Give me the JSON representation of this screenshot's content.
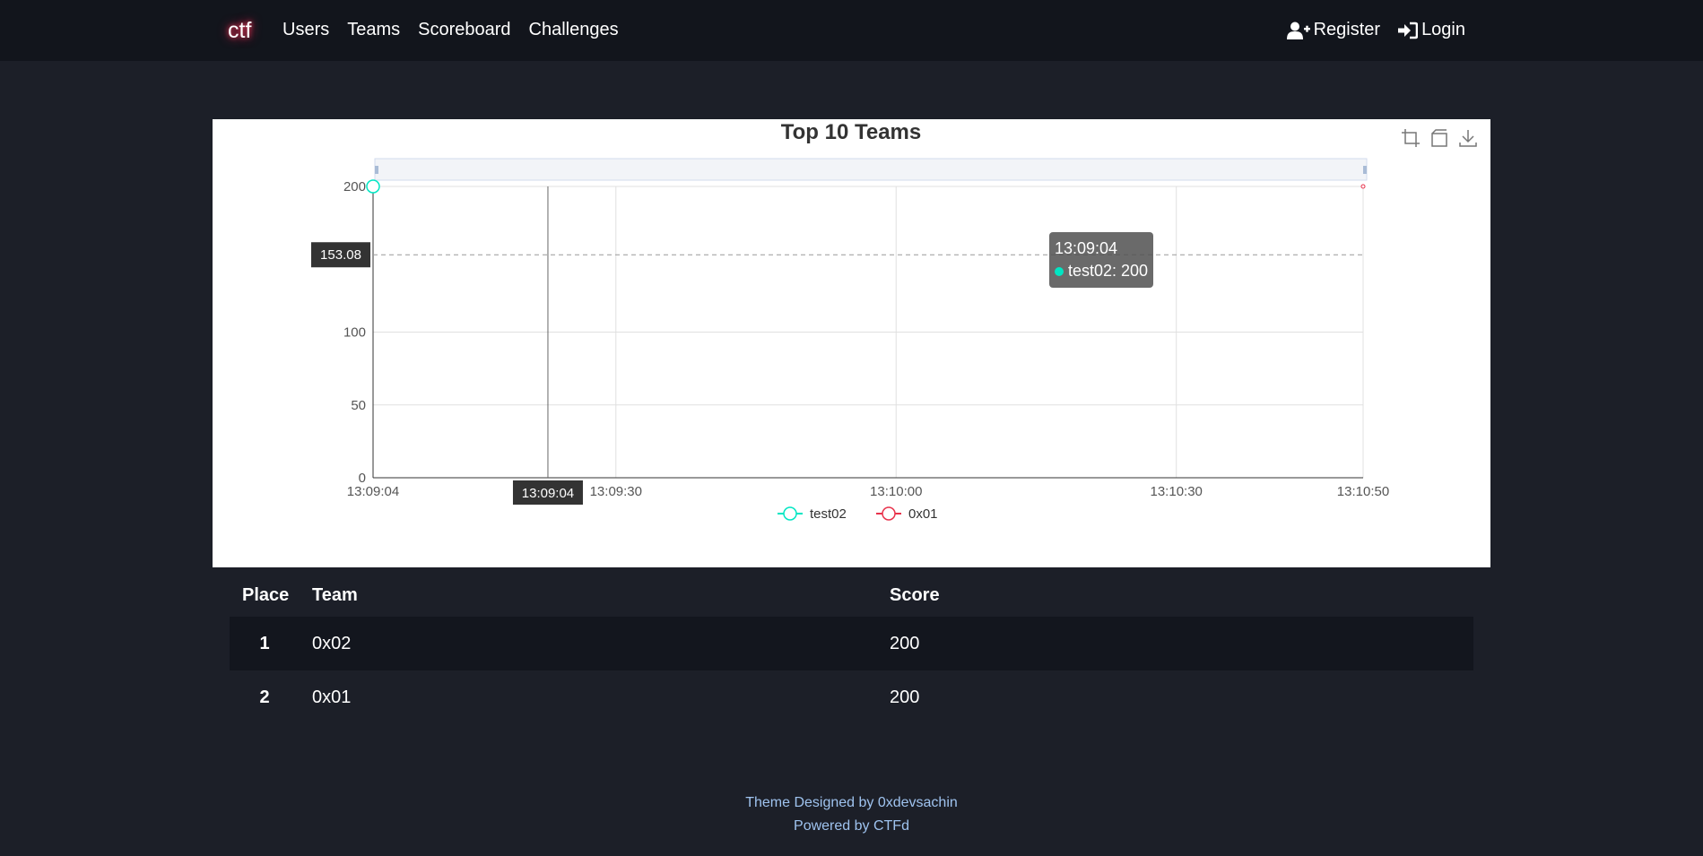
{
  "nav": {
    "brand": "ctf",
    "links": [
      "Users",
      "Teams",
      "Scoreboard",
      "Challenges"
    ],
    "register": "Register",
    "login": "Login"
  },
  "chart": {
    "tooltip": {
      "time": "13:09:04",
      "series": "test02",
      "value": "200",
      "label": "test02: 200"
    },
    "pointer_y_label": "153.08",
    "pointer_x_label": "13:09:04"
  },
  "chart_data": {
    "type": "line",
    "title": "Top 10 Teams",
    "xlabel": "",
    "ylabel": "",
    "x_ticks": [
      "13:09:04",
      "13:09:30",
      "13:10:00",
      "13:10:30",
      "13:10:50"
    ],
    "y_ticks": [
      0,
      50,
      100,
      200
    ],
    "ylim": [
      0,
      200
    ],
    "series": [
      {
        "name": "test02",
        "color": "#00e6c3",
        "points": [
          [
            "13:09:04",
            200
          ]
        ]
      },
      {
        "name": "0x01",
        "color": "#e8324b",
        "points": [
          [
            "13:10:50",
            200
          ]
        ]
      }
    ],
    "legend_position": "bottom-center",
    "grid": true
  },
  "table": {
    "headers": [
      "Place",
      "Team",
      "Score"
    ],
    "rows": [
      {
        "place": "1",
        "team": "0x02",
        "score": "200"
      },
      {
        "place": "2",
        "team": "0x01",
        "score": "200"
      }
    ]
  },
  "footer": {
    "line1": "Theme Designed by 0xdevsachin",
    "line2": "Powered by CTFd"
  },
  "colors": {
    "navbar": "#12151c",
    "background": "#1c1f28",
    "footer_text": "#9fc3ef"
  }
}
